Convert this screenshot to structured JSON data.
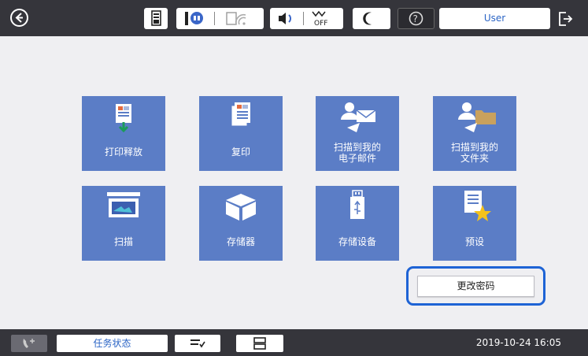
{
  "header": {
    "user_label": "User",
    "icons": [
      "back-icon",
      "printer-status-icon",
      "network-icon",
      "wifi-icon",
      "volume-icon",
      "power-off-icon",
      "moon-icon",
      "help-icon",
      "logout-icon"
    ]
  },
  "tiles": [
    {
      "label": "打印释放",
      "icon": "print-release-icon"
    },
    {
      "label": "复印",
      "icon": "copy-icon"
    },
    {
      "label": "扫描到我的电子邮件",
      "icon": "scan-to-email-icon"
    },
    {
      "label": "扫描到我的文件夹",
      "icon": "scan-to-folder-icon"
    },
    {
      "label": "扫描",
      "icon": "scan-icon"
    },
    {
      "label": "存储器",
      "icon": "storage-box-icon"
    },
    {
      "label": "存储设备",
      "icon": "usb-device-icon"
    },
    {
      "label": "预设",
      "icon": "preset-star-icon"
    }
  ],
  "change_password": "更改密码",
  "footer": {
    "task_status": "任务状态",
    "datetime": "2019-10-24 16:05"
  },
  "colors": {
    "tile": "#5b7dc6",
    "bar": "#35353b",
    "highlight": "#1e63d5",
    "accent_text": "#2a64c5"
  }
}
